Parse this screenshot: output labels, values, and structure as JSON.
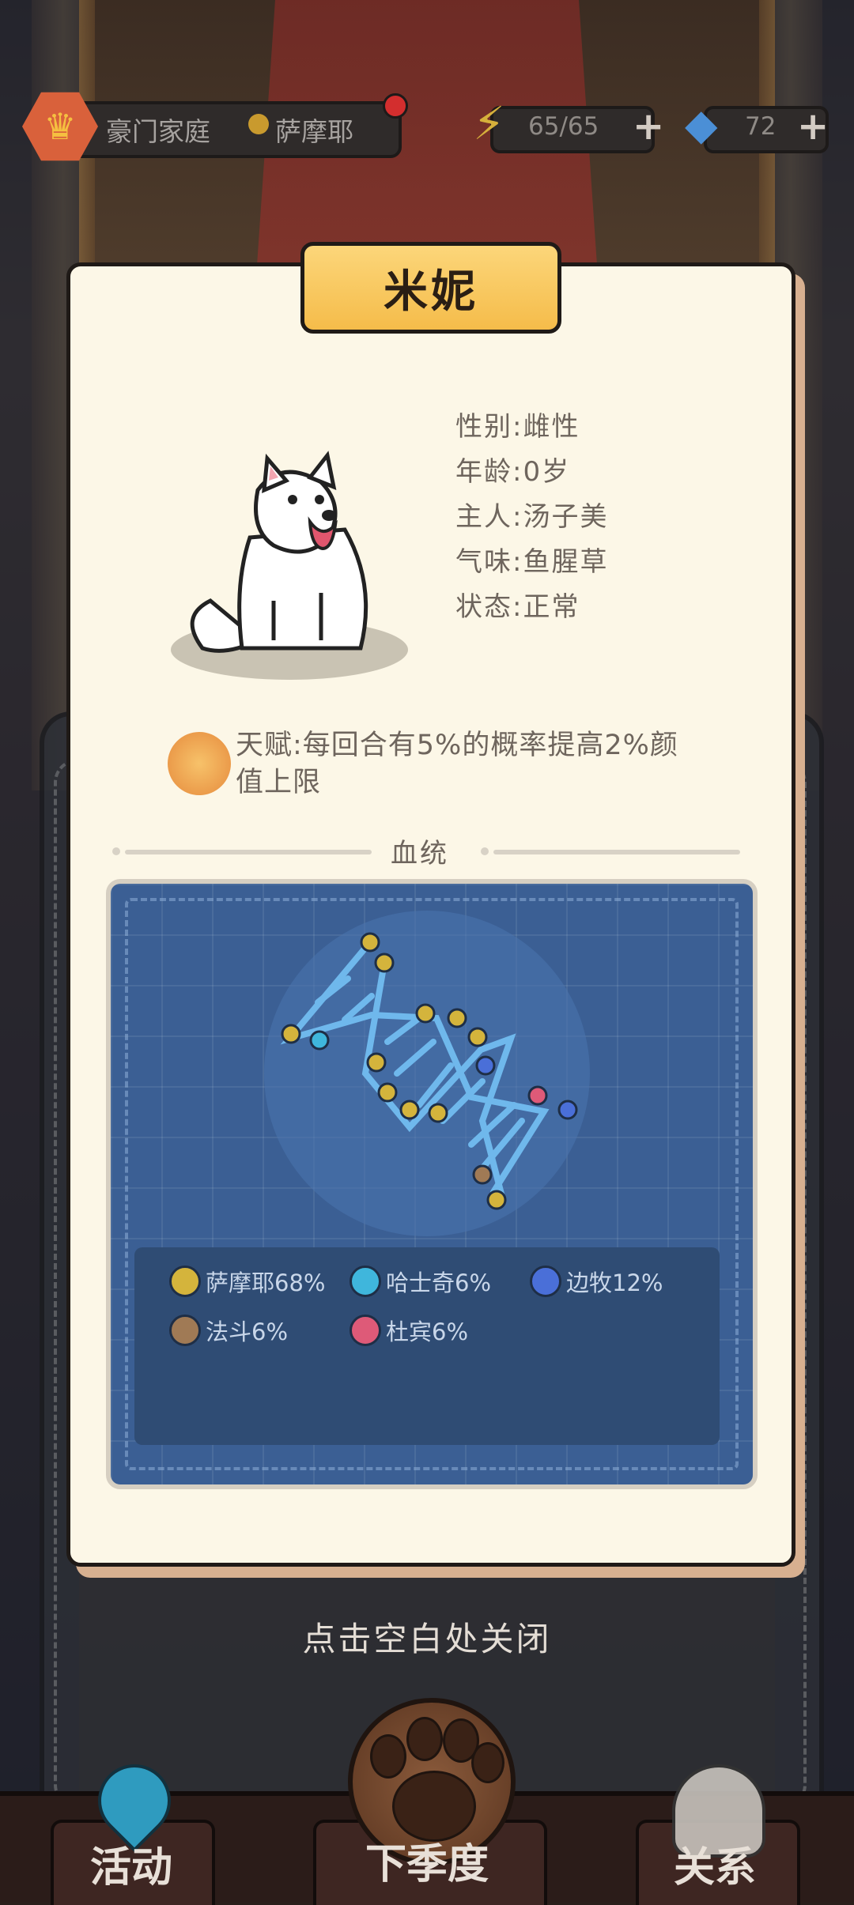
{
  "topbar": {
    "family_title": "豪门家庭",
    "breed_name": "萨摩耶",
    "energy": "65/65",
    "gems": "72",
    "plus_symbol": "+"
  },
  "pet": {
    "name": "米妮",
    "info": [
      "性别:雌性",
      "年龄:0岁",
      "主人:汤子美",
      "气味:鱼腥草",
      "状态:正常"
    ],
    "talent": "天赋:每回合有5%的概率提高2%颜值上限"
  },
  "lineage": {
    "title": "血统",
    "legend": [
      {
        "label": "萨摩耶68%",
        "color": "#d4b43c"
      },
      {
        "label": "哈士奇6%",
        "color": "#3fb6dc"
      },
      {
        "label": "边牧12%",
        "color": "#4a6fd8"
      },
      {
        "label": "法斗6%",
        "color": "#a07a55"
      },
      {
        "label": "杜宾6%",
        "color": "#de5a78"
      }
    ]
  },
  "close_hint": "点击空白处关闭",
  "nav": {
    "activity": "活动",
    "next_season": "下季度",
    "relations": "关系"
  }
}
